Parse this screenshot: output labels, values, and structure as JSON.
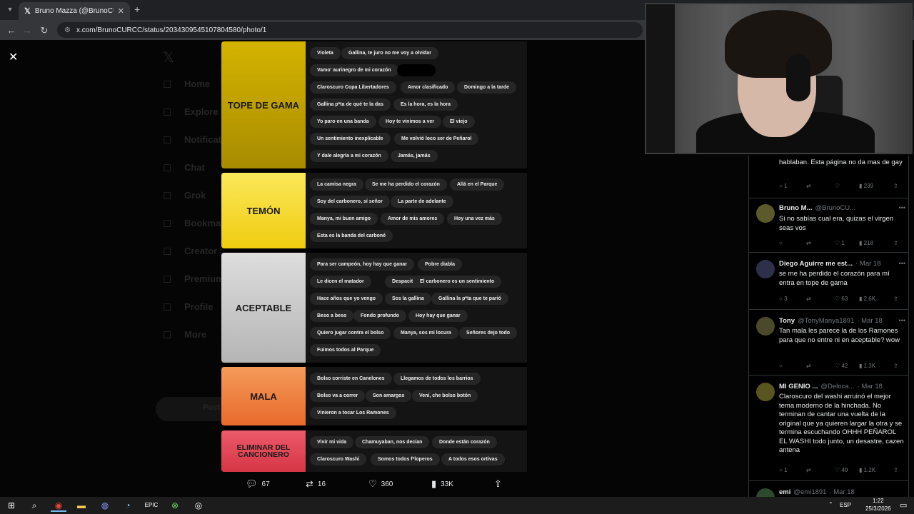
{
  "browser": {
    "tab_title": "Bruno Mazza (@BrunoCURCC)",
    "tab_icon": "x-logo-icon",
    "url": "x.com/BrunoCURCC/status/2034309545107804580/photo/1"
  },
  "background_sidebar": [
    "Home",
    "Explore",
    "Notifications",
    "Chat",
    "Grok",
    "Bookmarks",
    "Creator Studio",
    "Premium",
    "Profile",
    "More"
  ],
  "background_post_label": "Post",
  "tierlist": {
    "tiers": [
      {
        "label": "TOPE DE GAMA",
        "color": "#c9a800",
        "songs": [
          "Violeta",
          "Gallina, te juro no me voy a olvidar",
          "Vamo' aurinegro de mi corazón",
          "[redacted]",
          "Claroscuro Copa Libertadores",
          "Amor clasificado",
          "Domingo a la tarde",
          "Gallina p*ta de qué te la das",
          "Es la hora, es la hora",
          "Yo paro en una banda",
          "Hoy te vinimos a ver",
          "El viejo",
          "Un sentimiento inexplicable",
          "Me volvió loco ser de Peñarol",
          "Y dale alegría a mi corazón",
          "Jamás, jamás"
        ]
      },
      {
        "label": "TEMÓN",
        "color": "#f2d526",
        "songs": [
          "La camisa negra",
          "Se me ha perdido el corazón",
          "Allá en el Parque",
          "Soy del carbonero, sí señor",
          "La parte de adelante",
          "Manya, mi buen amigo",
          "Amor de mis amores",
          "Hoy una vez más",
          "Esta es la banda del carboné"
        ]
      },
      {
        "label": "ACEPTABLE",
        "color": "#c9c9c9",
        "songs": [
          "Para ser campeón, hoy hay que ganar",
          "Pobre diabla",
          "Le dicen el matador",
          "Despacito",
          "El carbonero es un sentimiento",
          "Hace años que yo vengo",
          "Sos la gallina",
          "Gallina la p*ta que te parió",
          "Beso a beso",
          "Fondo profundo",
          "Hoy hay que ganar",
          "Quiero jugar contra el bolso",
          "Manya, sos mi locura",
          "Señores dejo todo",
          "Fuimos todos al Parque"
        ]
      },
      {
        "label": "MALA",
        "color": "#f07a3a",
        "songs": [
          "Bolso corriste en Canelones",
          "Llegamos de todos los barrios",
          "Bolso va a correr",
          "Son amargos",
          "Vení, che bolso botón",
          "Vinieron a tocar Los Ramones"
        ]
      },
      {
        "label": "ELIMINAR DEL CANCIONERO",
        "color": "#e0404f",
        "songs": [
          "Vivir mi vida",
          "Chamuyaban, nos decían",
          "Donde están corazón",
          "Claroscuro Washi",
          "Somos todos f*loperos",
          "A todos esos ortivas"
        ]
      }
    ]
  },
  "post_actions": {
    "replies": "67",
    "reposts": "16",
    "likes": "360",
    "views": "33K"
  },
  "replies": [
    {
      "name": "",
      "handle": "",
      "date": "",
      "text": "hablaban. Esta página no da mas de gay",
      "stats": {
        "replies": "1",
        "reposts": "",
        "likes": "",
        "views": "239"
      }
    },
    {
      "name": "Bruno M...",
      "handle": "@BrunoCU...",
      "date": "· Mar 19",
      "text": "Si no sabías cual era, quizas el virgen seas vos",
      "stats": {
        "replies": "",
        "reposts": "",
        "likes": "1",
        "views": "218"
      }
    },
    {
      "name": "Diego Aguirre me est...",
      "handle": "",
      "date": "· Mar 18",
      "text": "se me ha perdido el corazón para mí entra en tope de gama",
      "stats": {
        "replies": "3",
        "reposts": "",
        "likes": "63",
        "views": "2.6K"
      }
    },
    {
      "name": "Tony",
      "handle": "@TonyManya1891",
      "date": "· Mar 18",
      "text": "Tan mala les parece la de los Ramones para que no entre ni en aceptable? wow",
      "stats": {
        "replies": "",
        "reposts": "",
        "likes": "42",
        "views": "1.3K"
      }
    },
    {
      "name": "MI GENIO ...",
      "handle": "@Deloca...",
      "date": "· Mar 18",
      "text": "Claroscuro del washi arruinó el mejor tema moderno de la hinchada. No terminan de cantar una vuelta de la original que ya quieren largar la otra y se termina escuchando OHHH PEÑAROL EL WASHI todo junto, un desastre, cazen antena",
      "stats": {
        "replies": "1",
        "reposts": "",
        "likes": "40",
        "views": "1.2K"
      }
    },
    {
      "name": "emi",
      "handle": "@emi1891",
      "date": "· Mar 18",
      "text": "",
      "stats": {
        "replies": "",
        "reposts": "",
        "likes": "",
        "views": ""
      }
    }
  ],
  "taskbar": {
    "language": "ESP",
    "time": "1:22",
    "date": "25/3/2026"
  }
}
